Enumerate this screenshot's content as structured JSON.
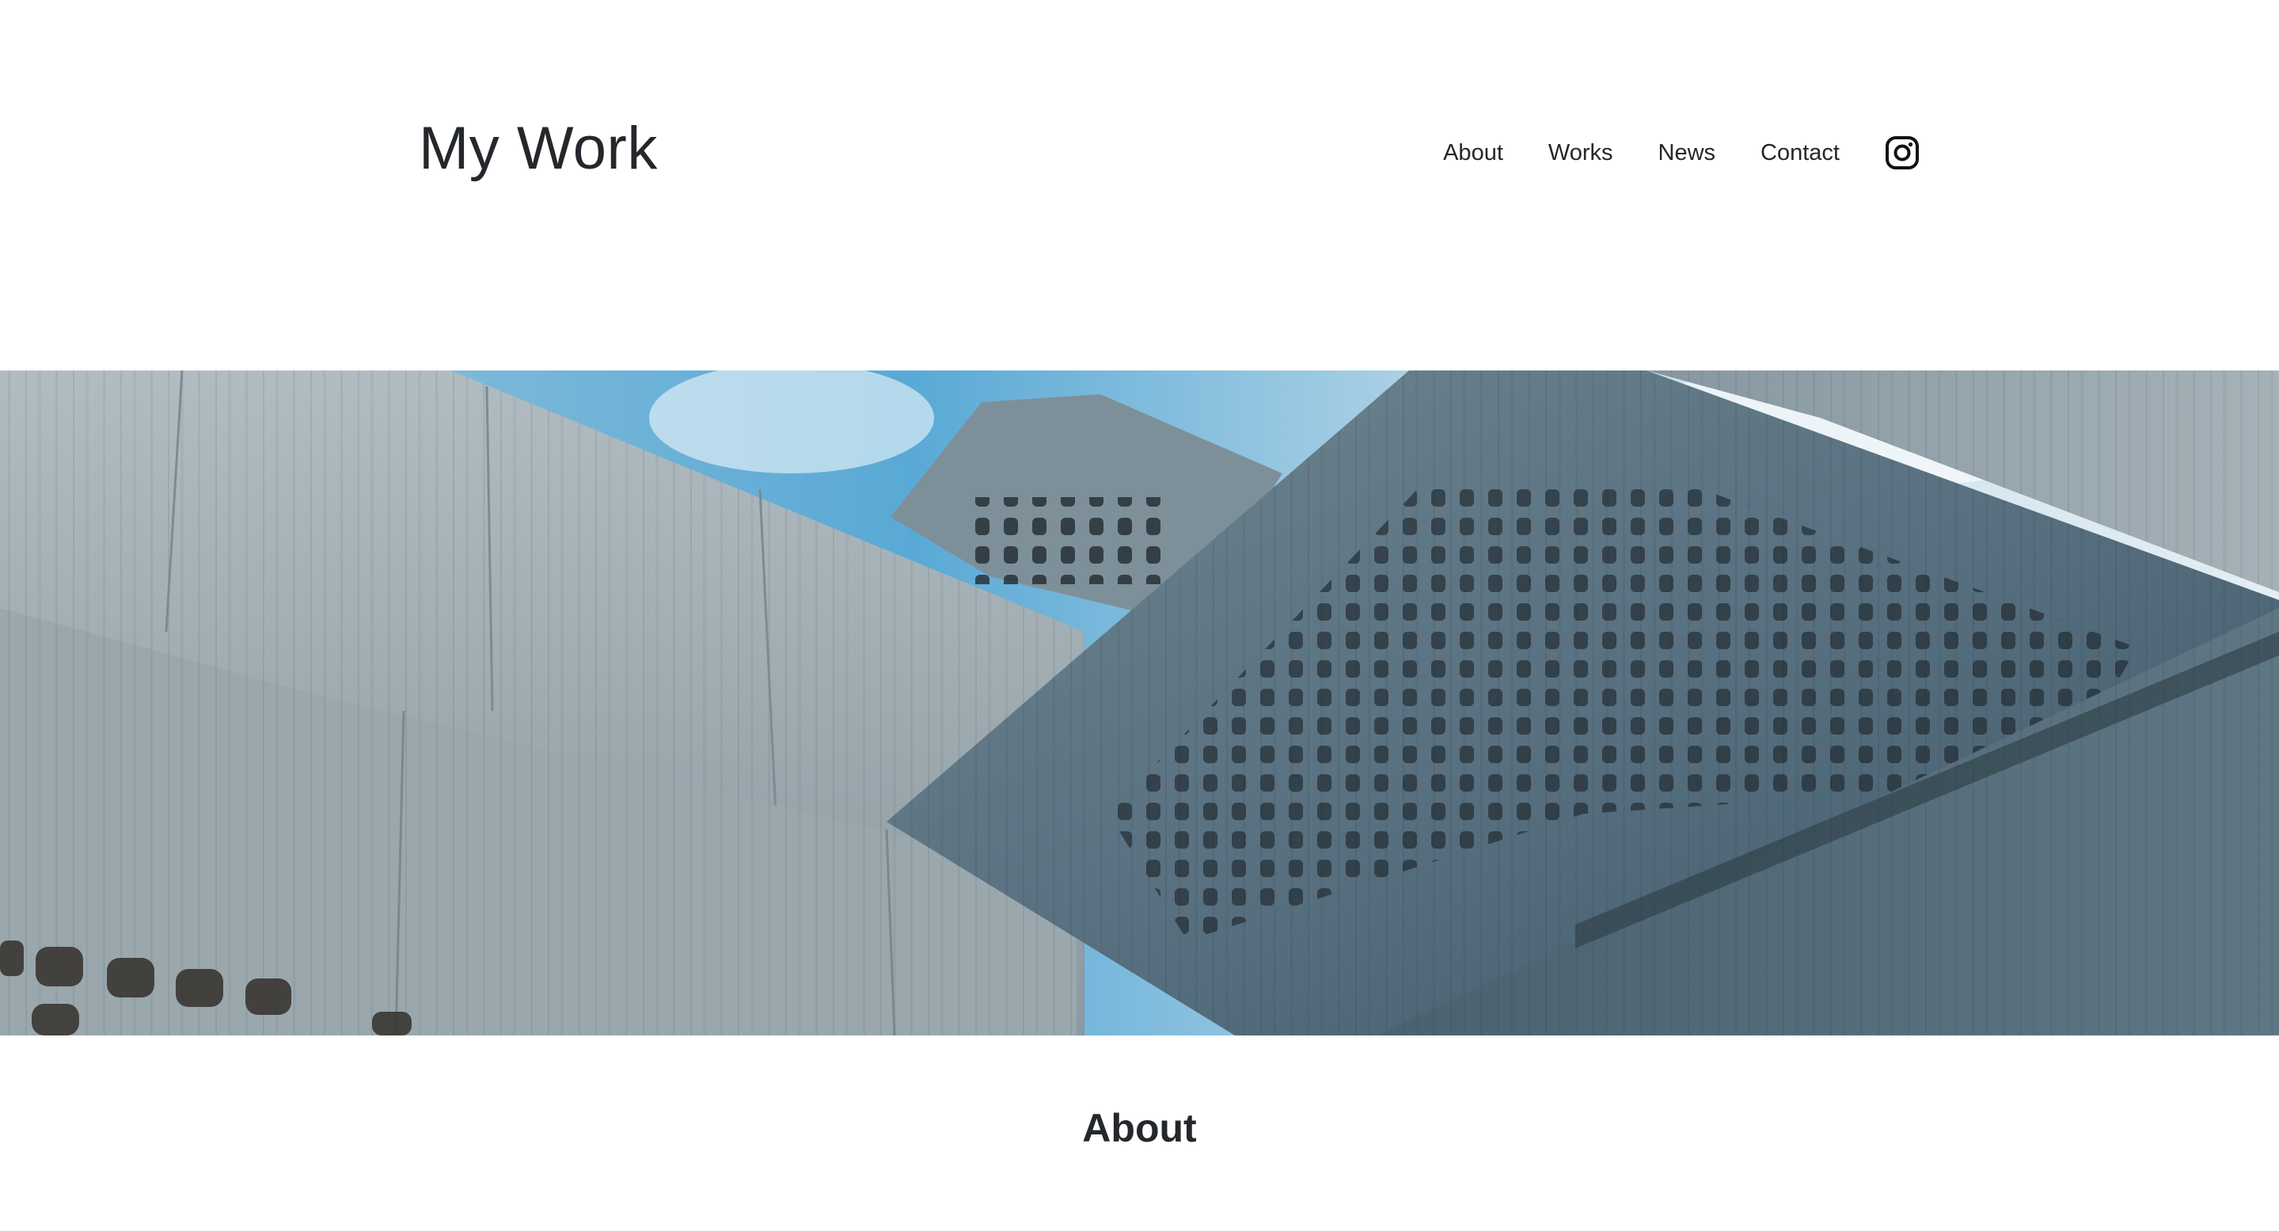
{
  "site": {
    "title": "My Work"
  },
  "nav": {
    "items": [
      {
        "label": "About"
      },
      {
        "label": "Works"
      },
      {
        "label": "News"
      },
      {
        "label": "Contact"
      }
    ],
    "social_icon": "instagram-icon"
  },
  "hero": {
    "image": "concrete-brutalist-building-photo",
    "colors": {
      "sky": "#8fc3dd",
      "concrete_light": "#a9b6bb",
      "concrete_mid": "#8a9aa2",
      "concrete_dark": "#4e6570"
    }
  },
  "about": {
    "heading": "About"
  }
}
